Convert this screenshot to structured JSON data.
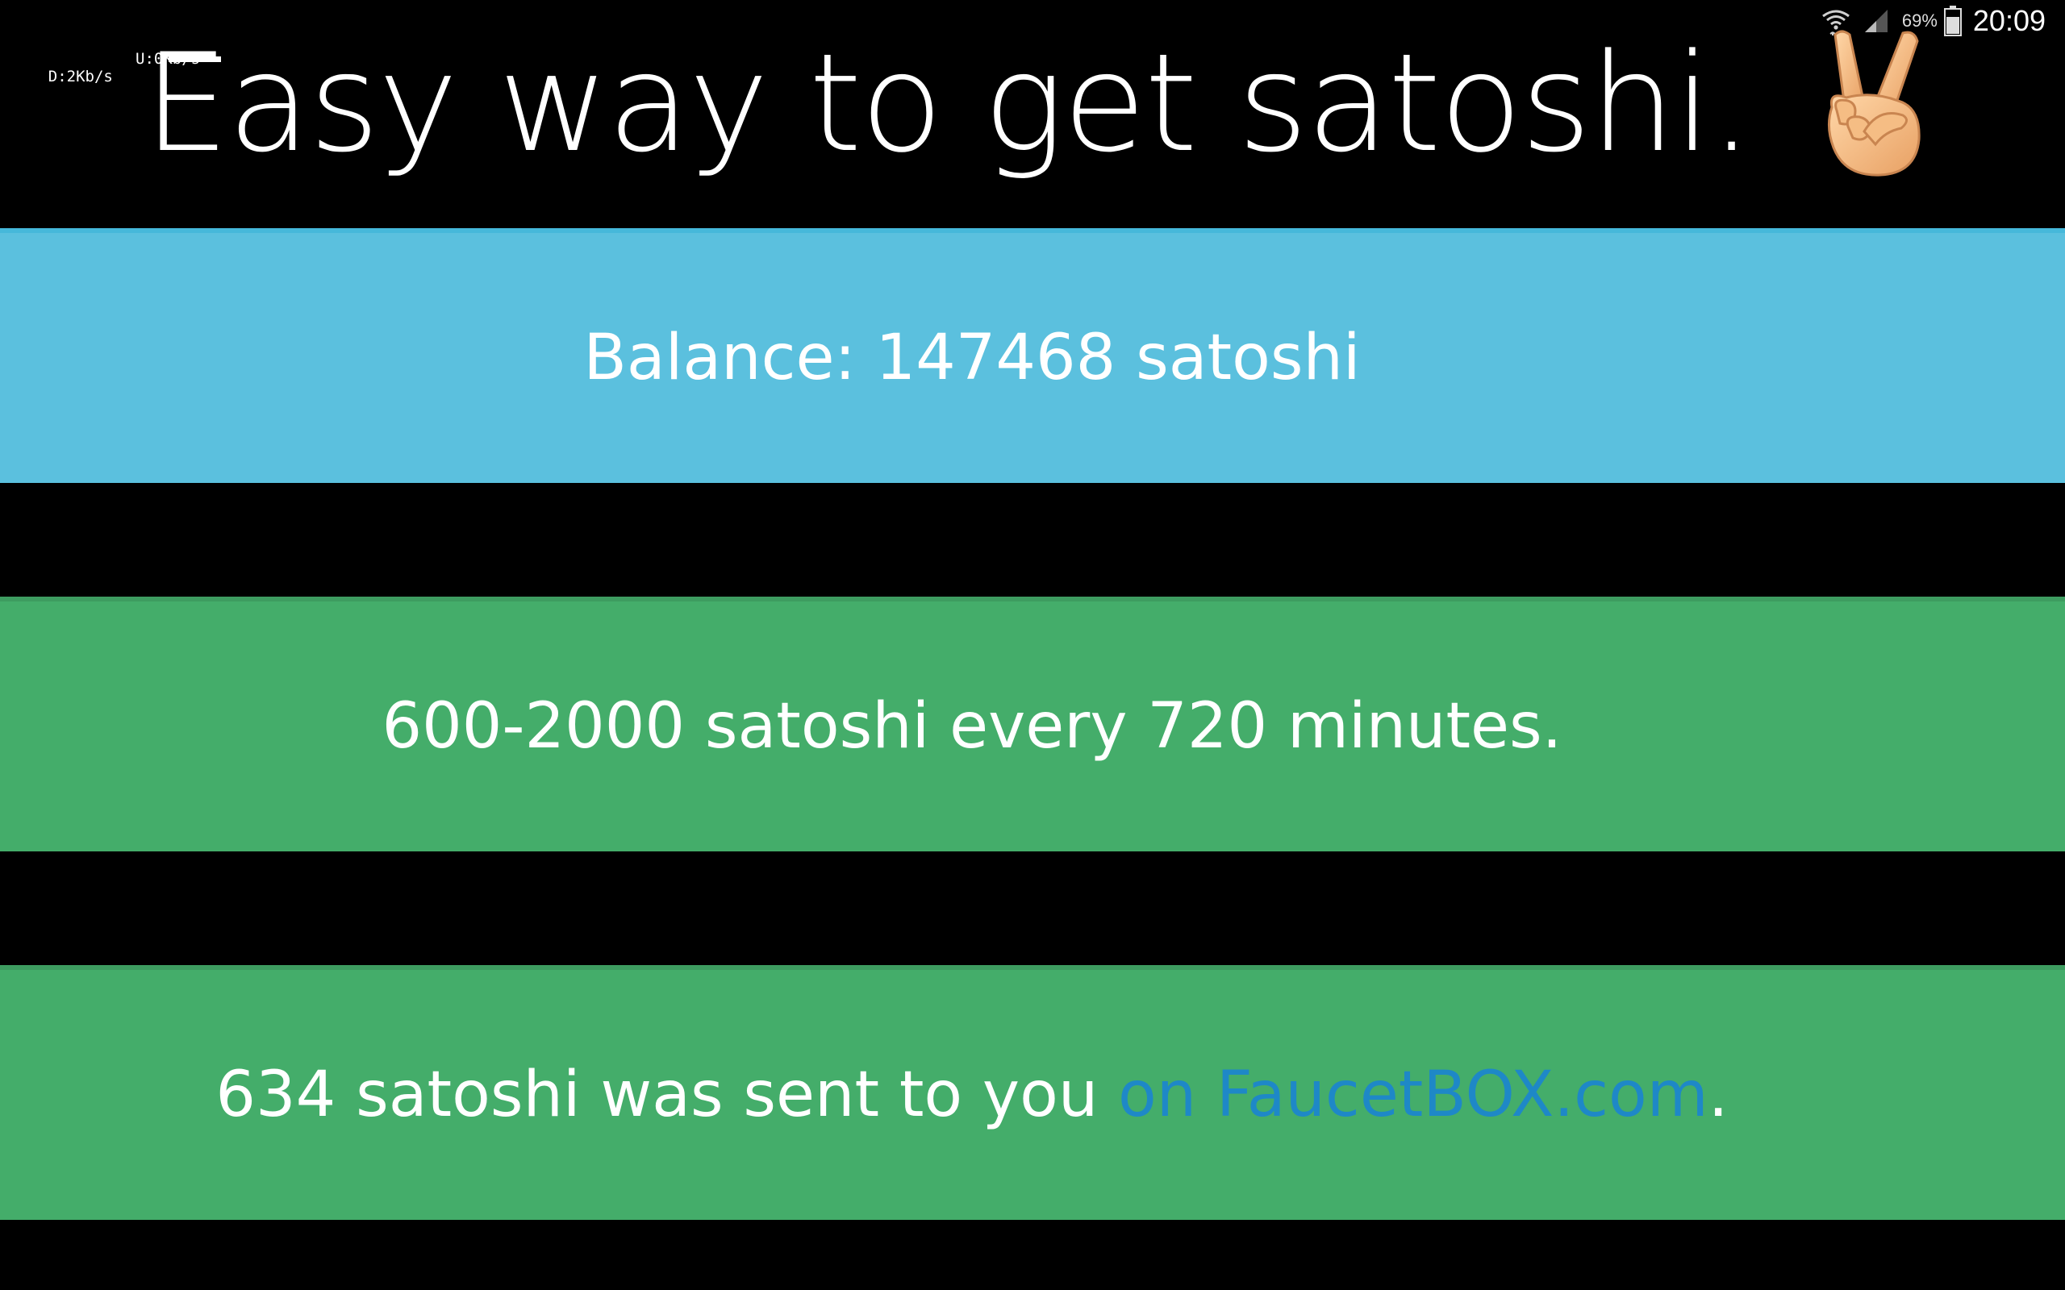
{
  "status_bar": {
    "battery_percent": "69%",
    "time": "20:09",
    "icons": [
      "wifi-icon",
      "signal-icon",
      "battery-icon"
    ]
  },
  "net_speed": {
    "download": "D:2Kb/s",
    "upload": "U:0Kb/s"
  },
  "header": {
    "title": "Easy way to get satoshi.",
    "emoji_icon": "victory-hand-icon"
  },
  "balance": {
    "text": "Balance: 147468 satoshi"
  },
  "rate": {
    "text": "600-2000 satoshi every 720 minutes."
  },
  "sent_message": {
    "prefix": "634 satoshi was sent to you ",
    "link_text": "on FaucetBOX.com",
    "suffix": "."
  },
  "colors": {
    "background": "#000000",
    "info_band": "#5bc0de",
    "success_band": "#44ad6a",
    "link": "#1e88c7",
    "text": "#ffffff"
  }
}
